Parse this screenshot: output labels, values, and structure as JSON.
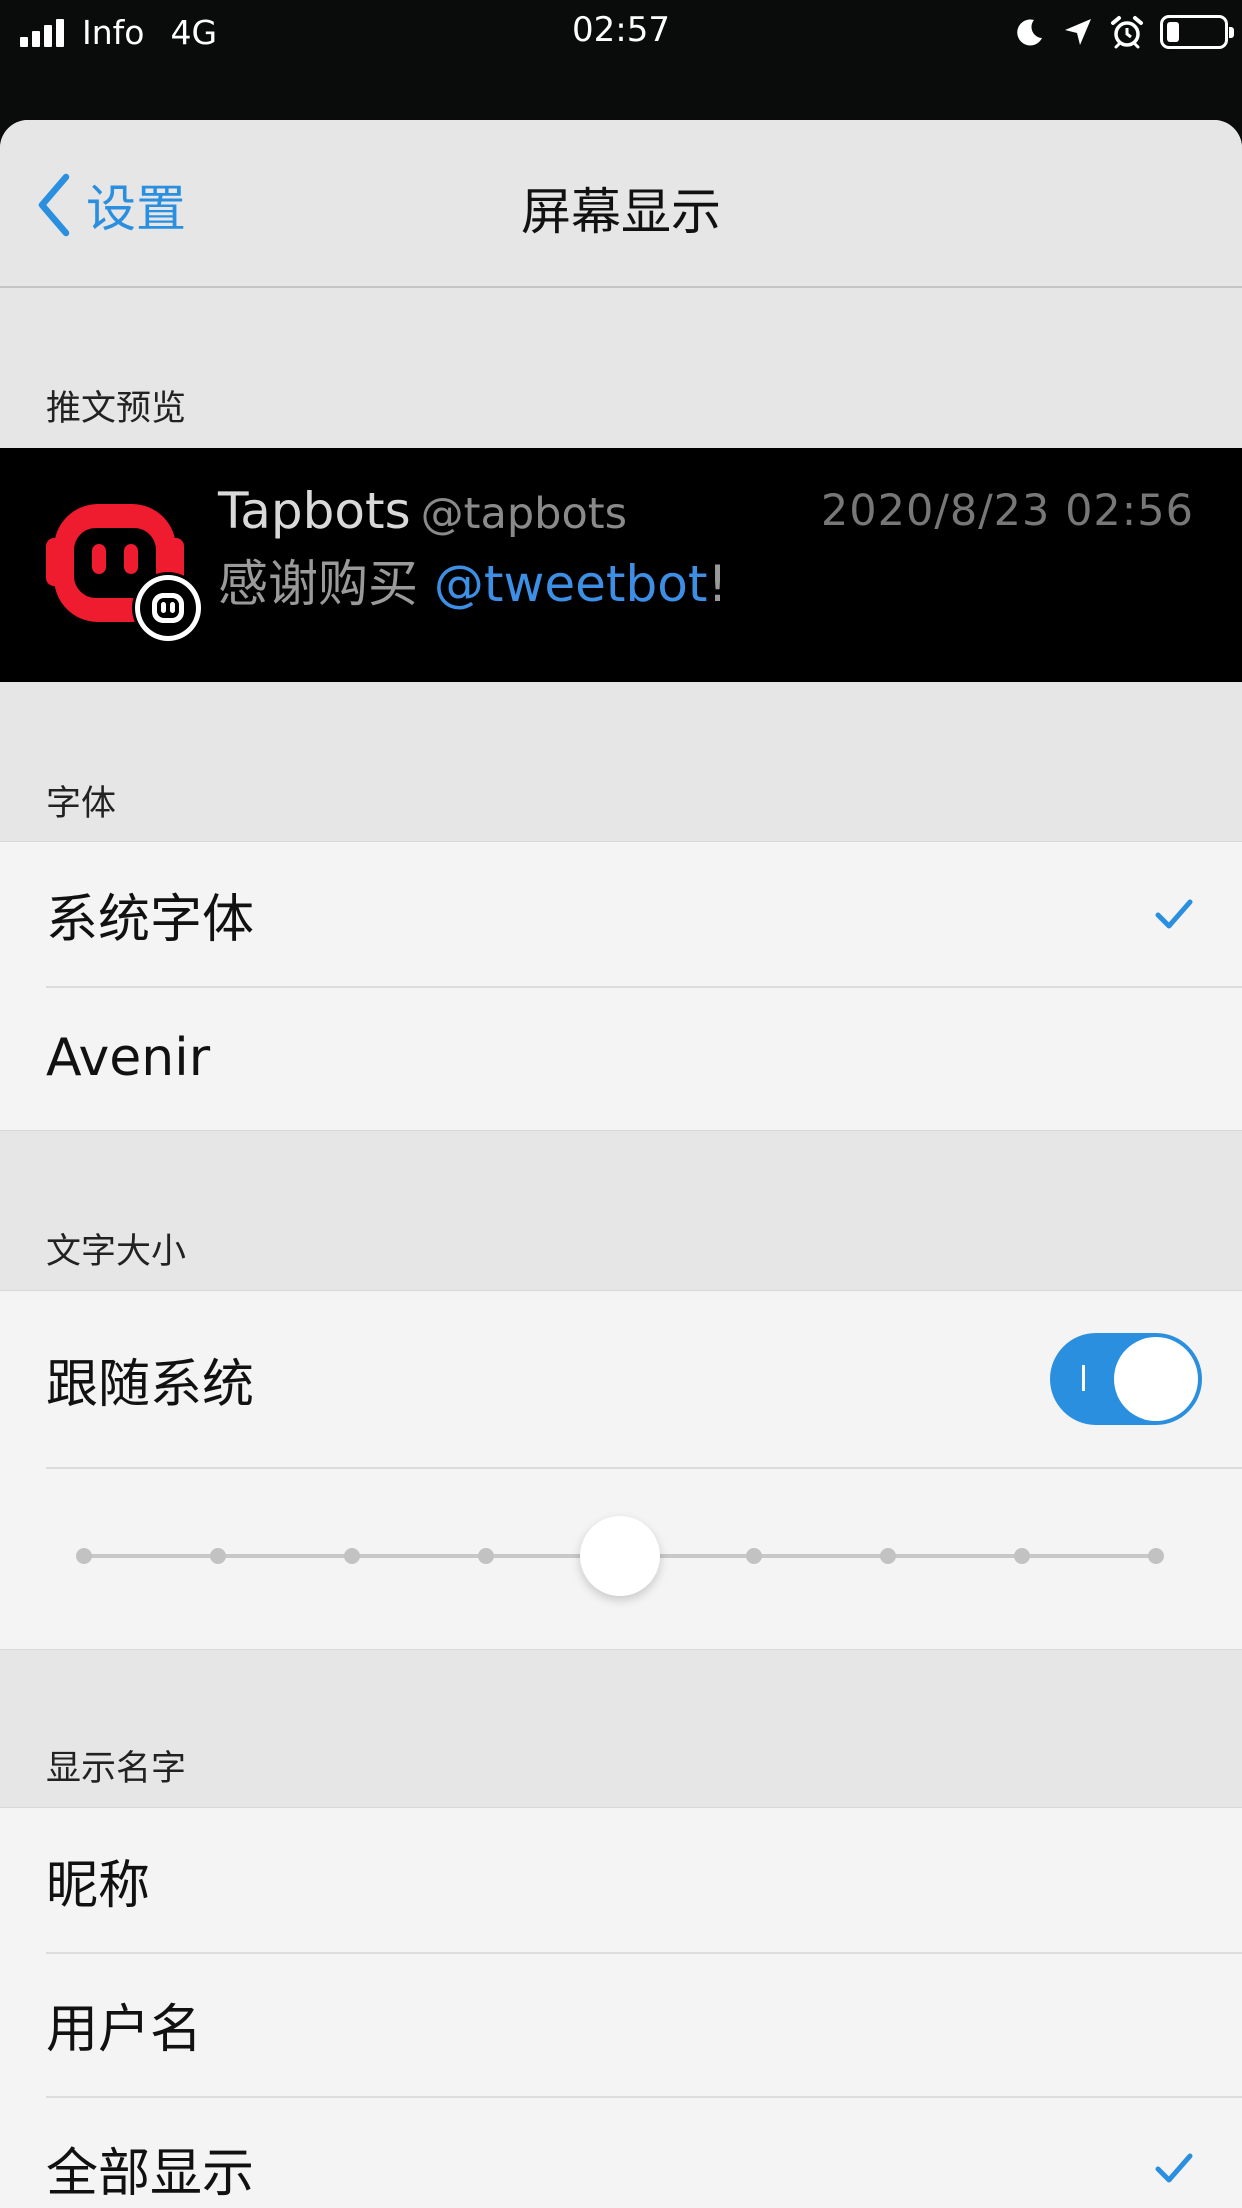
{
  "status_bar": {
    "carrier": "Info",
    "network": "4G",
    "time": "02:57",
    "icons": [
      "signal-icon",
      "moon-icon",
      "location-arrow-icon",
      "alarm-icon",
      "battery-icon"
    ]
  },
  "nav": {
    "back_label": "设置",
    "title": "屏幕显示"
  },
  "preview": {
    "header": "推文预览",
    "name": "Tapbots",
    "handle": "@tapbots",
    "timestamp": "2020/8/23 02:56",
    "text_before": "感谢购买 ",
    "mention": "@tweetbot",
    "text_after": "!"
  },
  "font": {
    "header": "字体",
    "options": [
      {
        "label": "系统字体",
        "selected": true
      },
      {
        "label": "Avenir",
        "selected": false
      }
    ]
  },
  "text_size": {
    "header": "文字大小",
    "follow_system_label": "跟随系统",
    "follow_system_on": true,
    "slider_steps": 9,
    "slider_selected_index": 4
  },
  "display_name": {
    "header": "显示名字",
    "options": [
      {
        "label": "昵称",
        "selected": false
      },
      {
        "label": "用户名",
        "selected": false
      },
      {
        "label": "全部显示",
        "selected": true
      }
    ]
  },
  "colors": {
    "accent": "#2b8fe0",
    "tapbots_red": "#ee1c2e",
    "background": "#e6e6e6",
    "cell": "#f4f4f4"
  }
}
